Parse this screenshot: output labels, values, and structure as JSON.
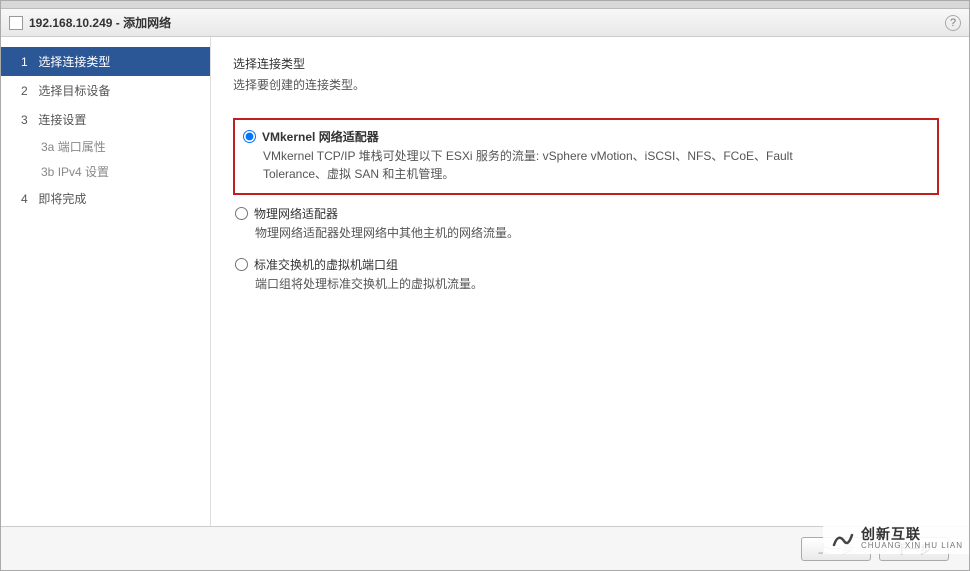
{
  "titlebar": {
    "title": "192.168.10.249 - 添加网络",
    "help_tooltip": "?"
  },
  "sidebar": {
    "steps": [
      {
        "num": "1",
        "label": "选择连接类型"
      },
      {
        "num": "2",
        "label": "选择目标设备"
      },
      {
        "num": "3",
        "label": "连接设置"
      },
      {
        "num": "4",
        "label": "即将完成"
      }
    ],
    "substeps": [
      {
        "prefix": "3a",
        "label": "端口属性"
      },
      {
        "prefix": "3b",
        "label": "IPv4 设置"
      }
    ]
  },
  "main": {
    "heading": "选择连接类型",
    "subheading": "选择要创建的连接类型。",
    "opt1": {
      "title": "VMkernel 网络适配器",
      "desc": "VMkernel TCP/IP 堆栈可处理以下 ESXi 服务的流量: vSphere vMotion、iSCSI、NFS、FCoE、Fault Tolerance、虚拟 SAN 和主机管理。"
    },
    "opt2": {
      "title": "物理网络适配器",
      "desc": "物理网络适配器处理网络中其他主机的网络流量。"
    },
    "opt3": {
      "title": "标准交换机的虚拟机端口组",
      "desc": "端口组将处理标准交换机上的虚拟机流量。"
    }
  },
  "footer": {
    "back": "上一步",
    "next": "下一步"
  },
  "watermark": {
    "big": "创新互联",
    "small": "CHUANG XIN HU LIAN"
  }
}
